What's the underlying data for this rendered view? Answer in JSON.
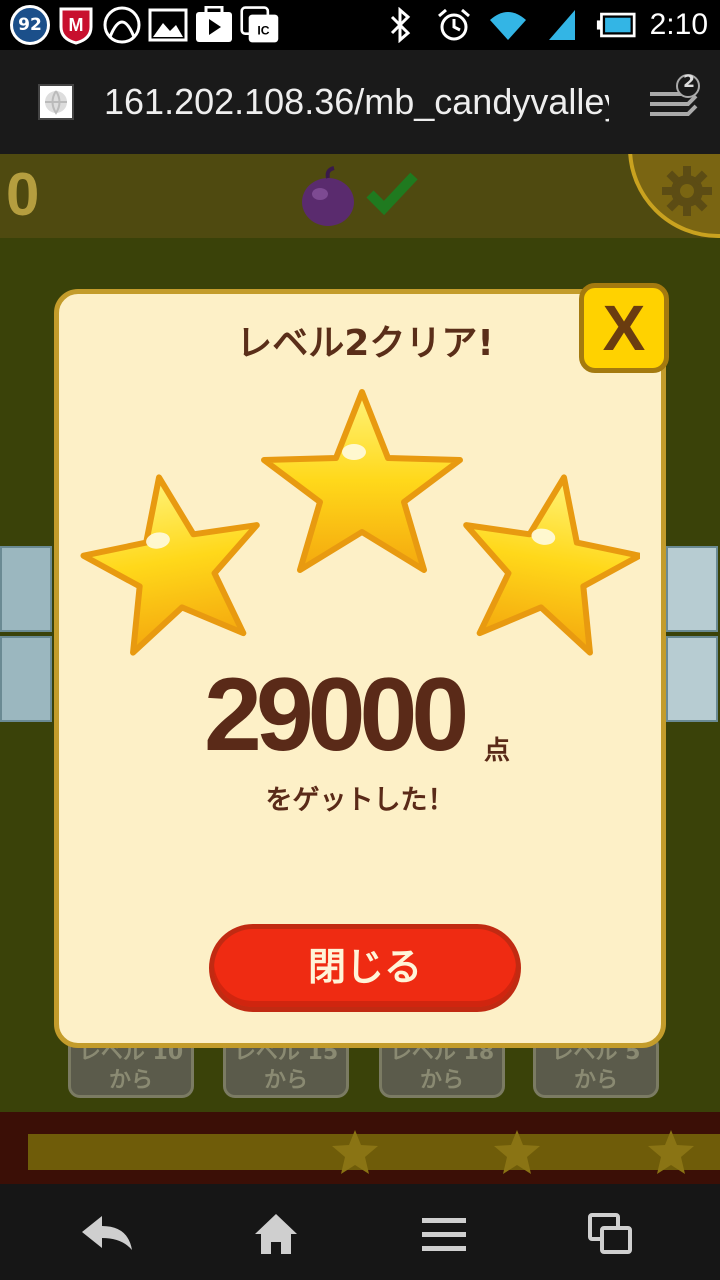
{
  "status_bar": {
    "notification_badge": "92",
    "time": "2:10",
    "icons": [
      "mcafee-icon",
      "arc-icon",
      "gallery-icon",
      "play-store-icon",
      "ic-card-icon",
      "bluetooth-icon",
      "alarm-icon",
      "wifi-icon",
      "signal-icon",
      "battery-icon"
    ]
  },
  "browser": {
    "url": "161.202.108.36/mb_candyvalley",
    "tab_count": "2"
  },
  "game": {
    "score_partial": "0",
    "level_buttons": [
      {
        "line1": "レベル 10",
        "line2": "から"
      },
      {
        "line1": "レベル 15",
        "line2": "から"
      },
      {
        "line1": "レベル 18",
        "line2": "から"
      },
      {
        "line1": "レベル 5",
        "line2": "から"
      }
    ]
  },
  "dialog": {
    "title": "レベル2クリア!",
    "close_x": "X",
    "stars_earned": 3,
    "score": "29000",
    "score_unit": "点",
    "message": "をゲットした！",
    "close_button": "閉じる"
  },
  "colors": {
    "dialog_bg": "#fdf0c7",
    "dialog_border": "#c39c2b",
    "close_button": "#ef2b12",
    "star_yellow": "#ffd21a",
    "text_brown": "#5a2a18"
  }
}
